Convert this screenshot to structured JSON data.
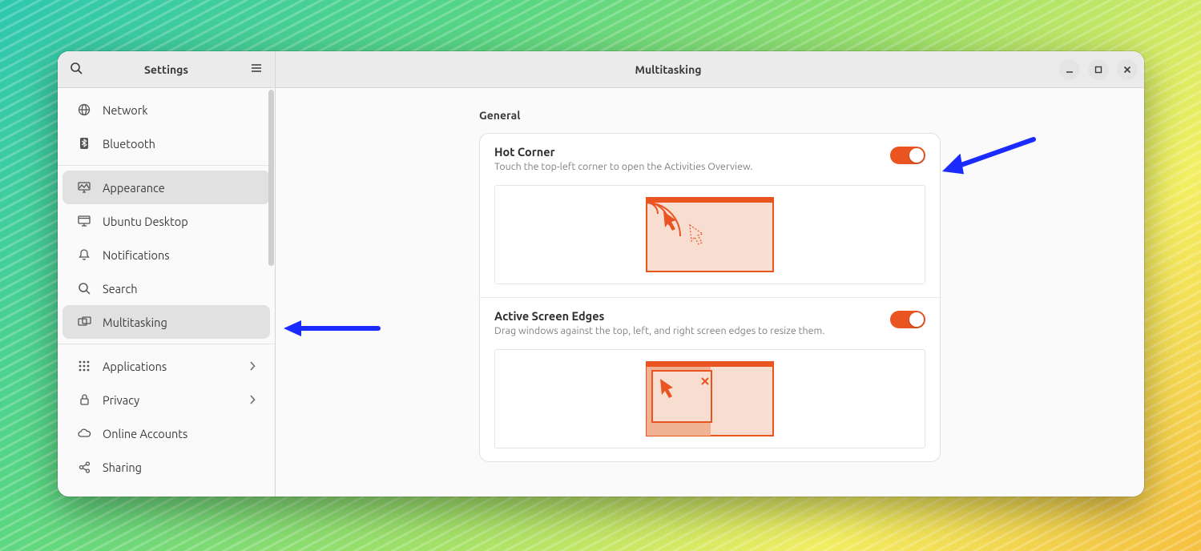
{
  "colors": {
    "accent": "#e95420",
    "illus_fill": "#f8ddd1",
    "illus_stroke": "#e95420"
  },
  "window": {
    "app_title": "Settings",
    "page_title": "Multitasking"
  },
  "sidebar": {
    "groups": [
      {
        "items": [
          {
            "id": "network",
            "label": "Network",
            "icon": "globe-icon"
          },
          {
            "id": "bluetooth",
            "label": "Bluetooth",
            "icon": "bluetooth-icon"
          }
        ]
      },
      {
        "items": [
          {
            "id": "appearance",
            "label": "Appearance",
            "icon": "appearance-icon"
          },
          {
            "id": "ubuntu-desktop",
            "label": "Ubuntu Desktop",
            "icon": "desktop-icon"
          },
          {
            "id": "notifications",
            "label": "Notifications",
            "icon": "bell-icon"
          },
          {
            "id": "search",
            "label": "Search",
            "icon": "search-icon"
          },
          {
            "id": "multitasking",
            "label": "Multitasking",
            "icon": "multitask-icon",
            "selected": true
          }
        ]
      },
      {
        "items": [
          {
            "id": "applications",
            "label": "Applications",
            "icon": "grid-icon",
            "chevron": true
          },
          {
            "id": "privacy",
            "label": "Privacy",
            "icon": "lock-icon",
            "chevron": true
          },
          {
            "id": "online-accounts",
            "label": "Online Accounts",
            "icon": "cloud-icon"
          },
          {
            "id": "sharing",
            "label": "Sharing",
            "icon": "share-icon"
          }
        ]
      }
    ]
  },
  "content": {
    "section_title": "General",
    "rows": [
      {
        "id": "hot-corner",
        "title": "Hot Corner",
        "subtitle": "Touch the top-left corner to open the Activities Overview.",
        "toggle": true,
        "illustration": "hot-corner"
      },
      {
        "id": "active-edges",
        "title": "Active Screen Edges",
        "subtitle": "Drag windows against the top, left, and right screen edges to resize them.",
        "toggle": true,
        "illustration": "active-edges"
      }
    ]
  }
}
